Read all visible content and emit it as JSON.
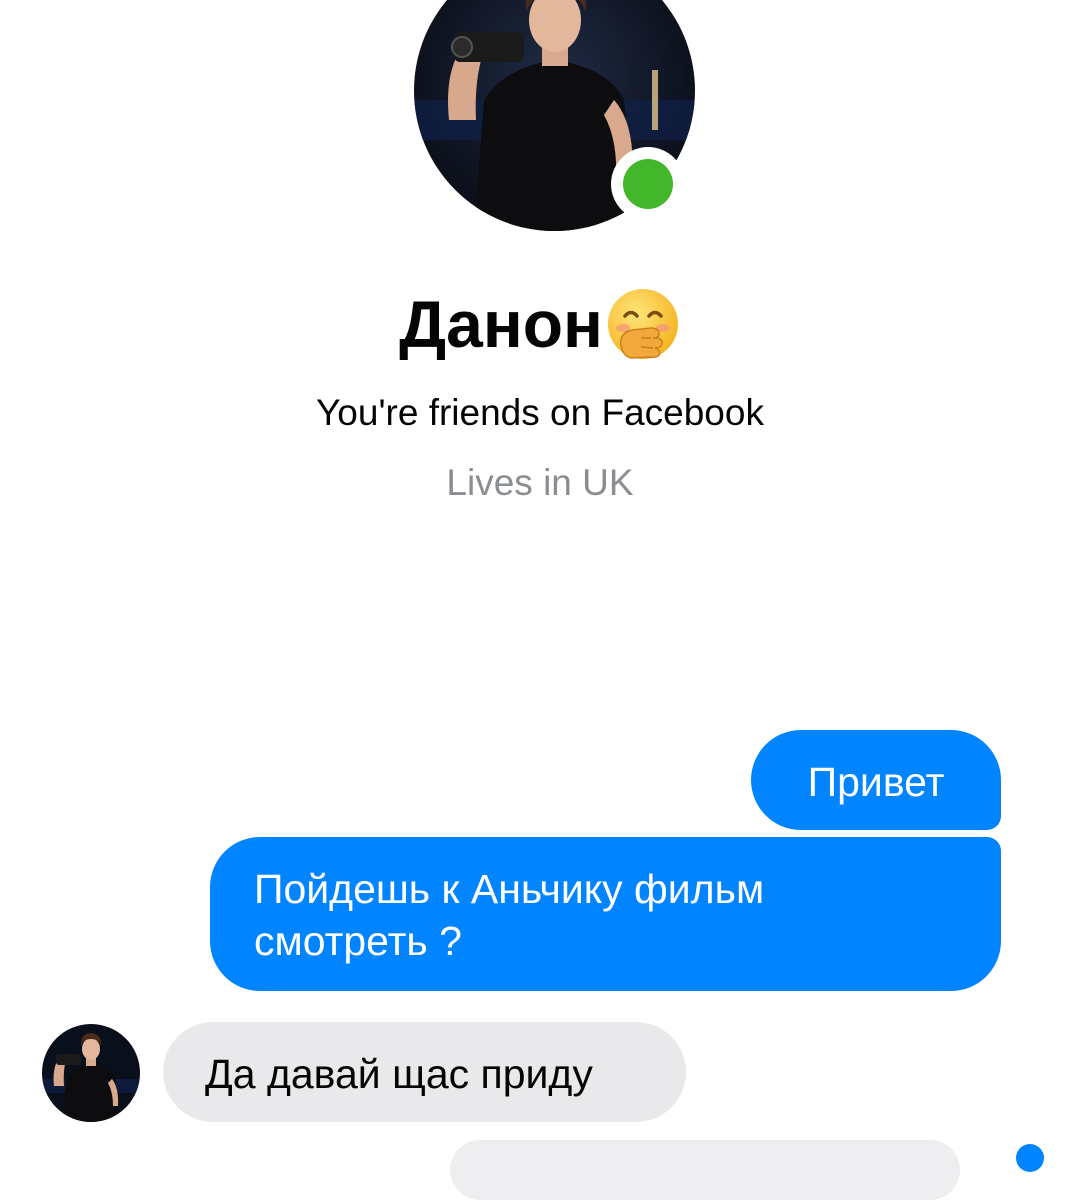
{
  "colors": {
    "accent": "#0084ff",
    "online": "#42b72a",
    "incoming_bubble": "#e9e9eb",
    "muted_text": "#8a8d91"
  },
  "profile": {
    "photo_icon": "profile-photo",
    "name": "Данон",
    "name_emoji_icon": "face-with-hand-over-mouth-emoji",
    "status_icon": "online-status-dot",
    "friends_text": "You're friends on Facebook",
    "lives_text": "Lives in UK"
  },
  "messages": [
    {
      "direction": "outgoing",
      "text": "Привет"
    },
    {
      "direction": "outgoing",
      "text": "Пойдешь к Аньчику фильм\nсмотреть ?"
    },
    {
      "direction": "incoming",
      "text": "Да давай щас приду",
      "avatar_icon": "sender-avatar"
    }
  ]
}
